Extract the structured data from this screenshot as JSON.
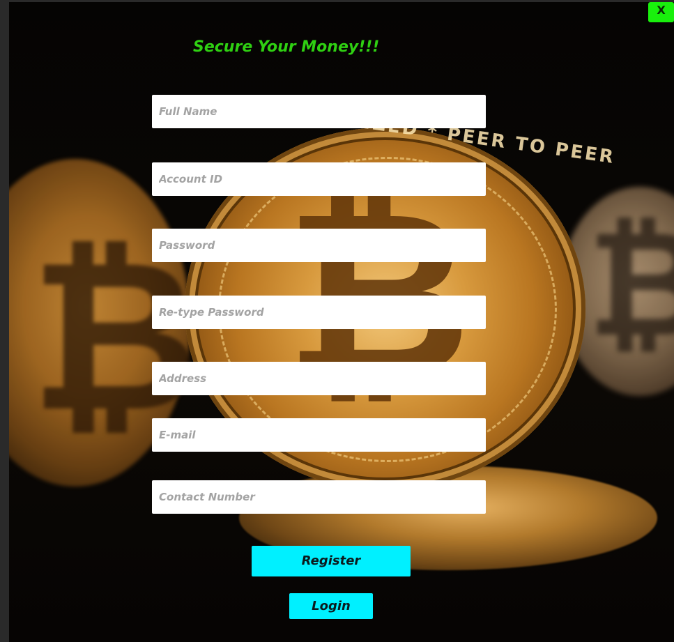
{
  "window": {
    "close_label": "X",
    "accent_color": "#19f00d"
  },
  "form": {
    "title": "Secure Your Money!!!",
    "title_color": "#2fd012",
    "fields": [
      {
        "name": "full-name-input",
        "placeholder": "Full Name",
        "value": ""
      },
      {
        "name": "account-id-input",
        "placeholder": "Account ID",
        "value": ""
      },
      {
        "name": "password-input",
        "placeholder": "Password",
        "value": ""
      },
      {
        "name": "retype-password-input",
        "placeholder": "Re-type Password",
        "value": ""
      },
      {
        "name": "address-input",
        "placeholder": "Address",
        "value": ""
      },
      {
        "name": "email-input",
        "placeholder": "E-mail",
        "value": ""
      },
      {
        "name": "contact-number-input",
        "placeholder": "Contact Number",
        "value": ""
      }
    ],
    "register_label": "Register",
    "login_label": "Login",
    "button_color": "#00f0ff"
  },
  "background": {
    "image": "bitcoin-coins-photo",
    "coin_text": "ALIZED * PEER TO PEER"
  }
}
